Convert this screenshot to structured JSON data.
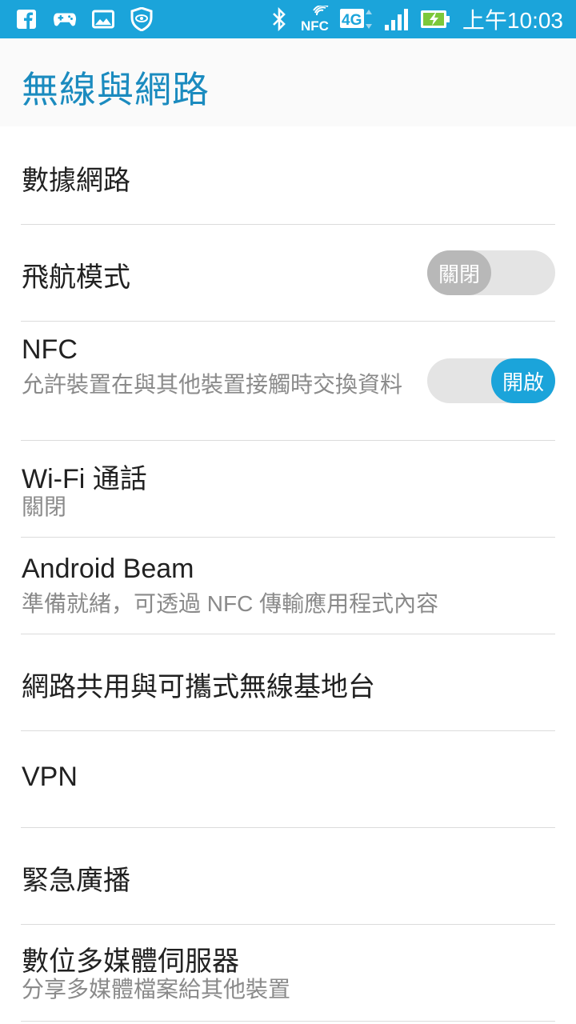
{
  "status_bar": {
    "time": "上午10:03",
    "icons_left": [
      "facebook-icon",
      "gamepad-icon",
      "image-icon",
      "shield-eye-icon"
    ],
    "icons_right": [
      "bluetooth-icon",
      "nfc-icon",
      "4g-icon",
      "signal-icon",
      "battery-charging-icon"
    ],
    "nfc_label": "NFC",
    "network_label": "4G",
    "accent": "#1ba4da"
  },
  "header": {
    "title": "無線與網路",
    "title_color": "#1b8bbf"
  },
  "settings": [
    {
      "id": "data-network",
      "title": "數據網路"
    },
    {
      "id": "airplane-mode",
      "title": "飛航模式",
      "switch": "關閉"
    },
    {
      "id": "nfc",
      "title": "NFC",
      "subtitle": "允許裝置在與其他裝置接觸時交換資料",
      "switch": "開啟"
    },
    {
      "id": "wifi-calling",
      "title": "Wi-Fi 通話",
      "subtitle": "關閉"
    },
    {
      "id": "android-beam",
      "title": "Android Beam",
      "subtitle": "準備就緒，可透過 NFC 傳輸應用程式內容"
    },
    {
      "id": "tethering",
      "title": "網路共用與可攜式無線基地台"
    },
    {
      "id": "vpn",
      "title": "VPN"
    },
    {
      "id": "emergency-broadcast",
      "title": "緊急廣播"
    },
    {
      "id": "media-server",
      "title": "數位多媒體伺服器",
      "subtitle": "分享多媒體檔案給其他裝置"
    }
  ]
}
